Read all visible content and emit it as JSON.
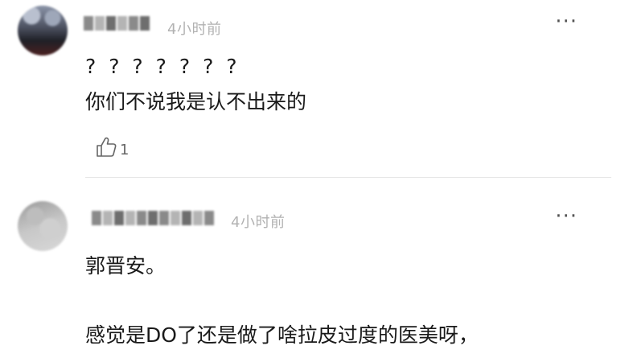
{
  "comments": [
    {
      "time": "4小时前",
      "more_label": "···",
      "lines": [
        "? ? ? ? ? ? ?",
        "你们不说我是认不出来的"
      ],
      "likes": "1",
      "icons": {
        "like": "thumbs-up-icon",
        "more": "ellipsis-icon"
      }
    },
    {
      "time": "4小时前",
      "more_label": "···",
      "lines": [
        "郭晋安。",
        "感觉是DO了还是做了啥拉皮过度的医美呀，"
      ]
    }
  ]
}
